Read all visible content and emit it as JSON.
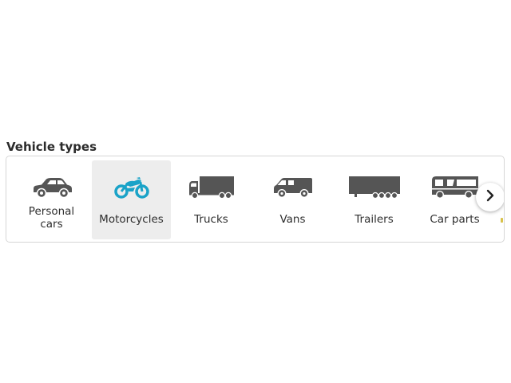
{
  "section": {
    "title": "Vehicle types"
  },
  "tiles": [
    {
      "label_line1": "Personal",
      "label_line2": "cars",
      "icon": "car-icon"
    },
    {
      "label": "Motorcycles",
      "icon": "motorcycle-icon",
      "selected": true
    },
    {
      "label": "Trucks",
      "icon": "truck-icon"
    },
    {
      "label": "Vans",
      "icon": "van-icon"
    },
    {
      "label": "Trailers",
      "icon": "trailer-icon"
    },
    {
      "label": "Car parts",
      "icon": "bus-icon"
    }
  ],
  "colors": {
    "icon_default": "#555555",
    "icon_selected": "#1aa3c8",
    "selected_bg": "#ededed",
    "border": "#d6d6d6"
  },
  "next_button": {
    "icon": "chevron-right-icon"
  }
}
